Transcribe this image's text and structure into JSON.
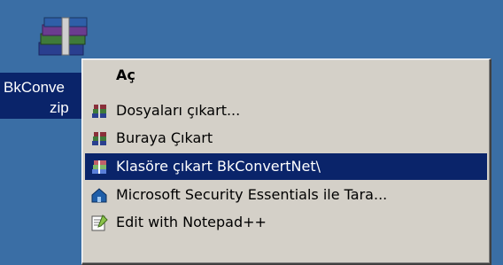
{
  "desktop": {
    "selected_icon": {
      "label_line1": "BkConve",
      "label_line2": "zip",
      "icon": "winrar-archive-icon"
    }
  },
  "context_menu": {
    "items": [
      {
        "label": "Aç",
        "icon": "none",
        "default": true
      },
      {
        "label": "Dosyaları çıkart...",
        "icon": "winrar-books-icon"
      },
      {
        "label": "Buraya Çıkart",
        "icon": "winrar-books-icon"
      },
      {
        "label": "Klasöre çıkart BkConvertNet\\",
        "icon": "winrar-books-icon",
        "highlighted": true
      },
      {
        "label": "Microsoft Security Essentials ile Tara...",
        "icon": "microsoft-security-essentials-icon"
      },
      {
        "label": "Edit with Notepad++",
        "icon": "notepad-plus-plus-icon"
      }
    ]
  },
  "colors": {
    "desktop_bg": "#3a6ea5",
    "menu_bg": "#d4d0c8",
    "highlight_bg": "#0a246a",
    "highlight_text": "#ffffff"
  }
}
